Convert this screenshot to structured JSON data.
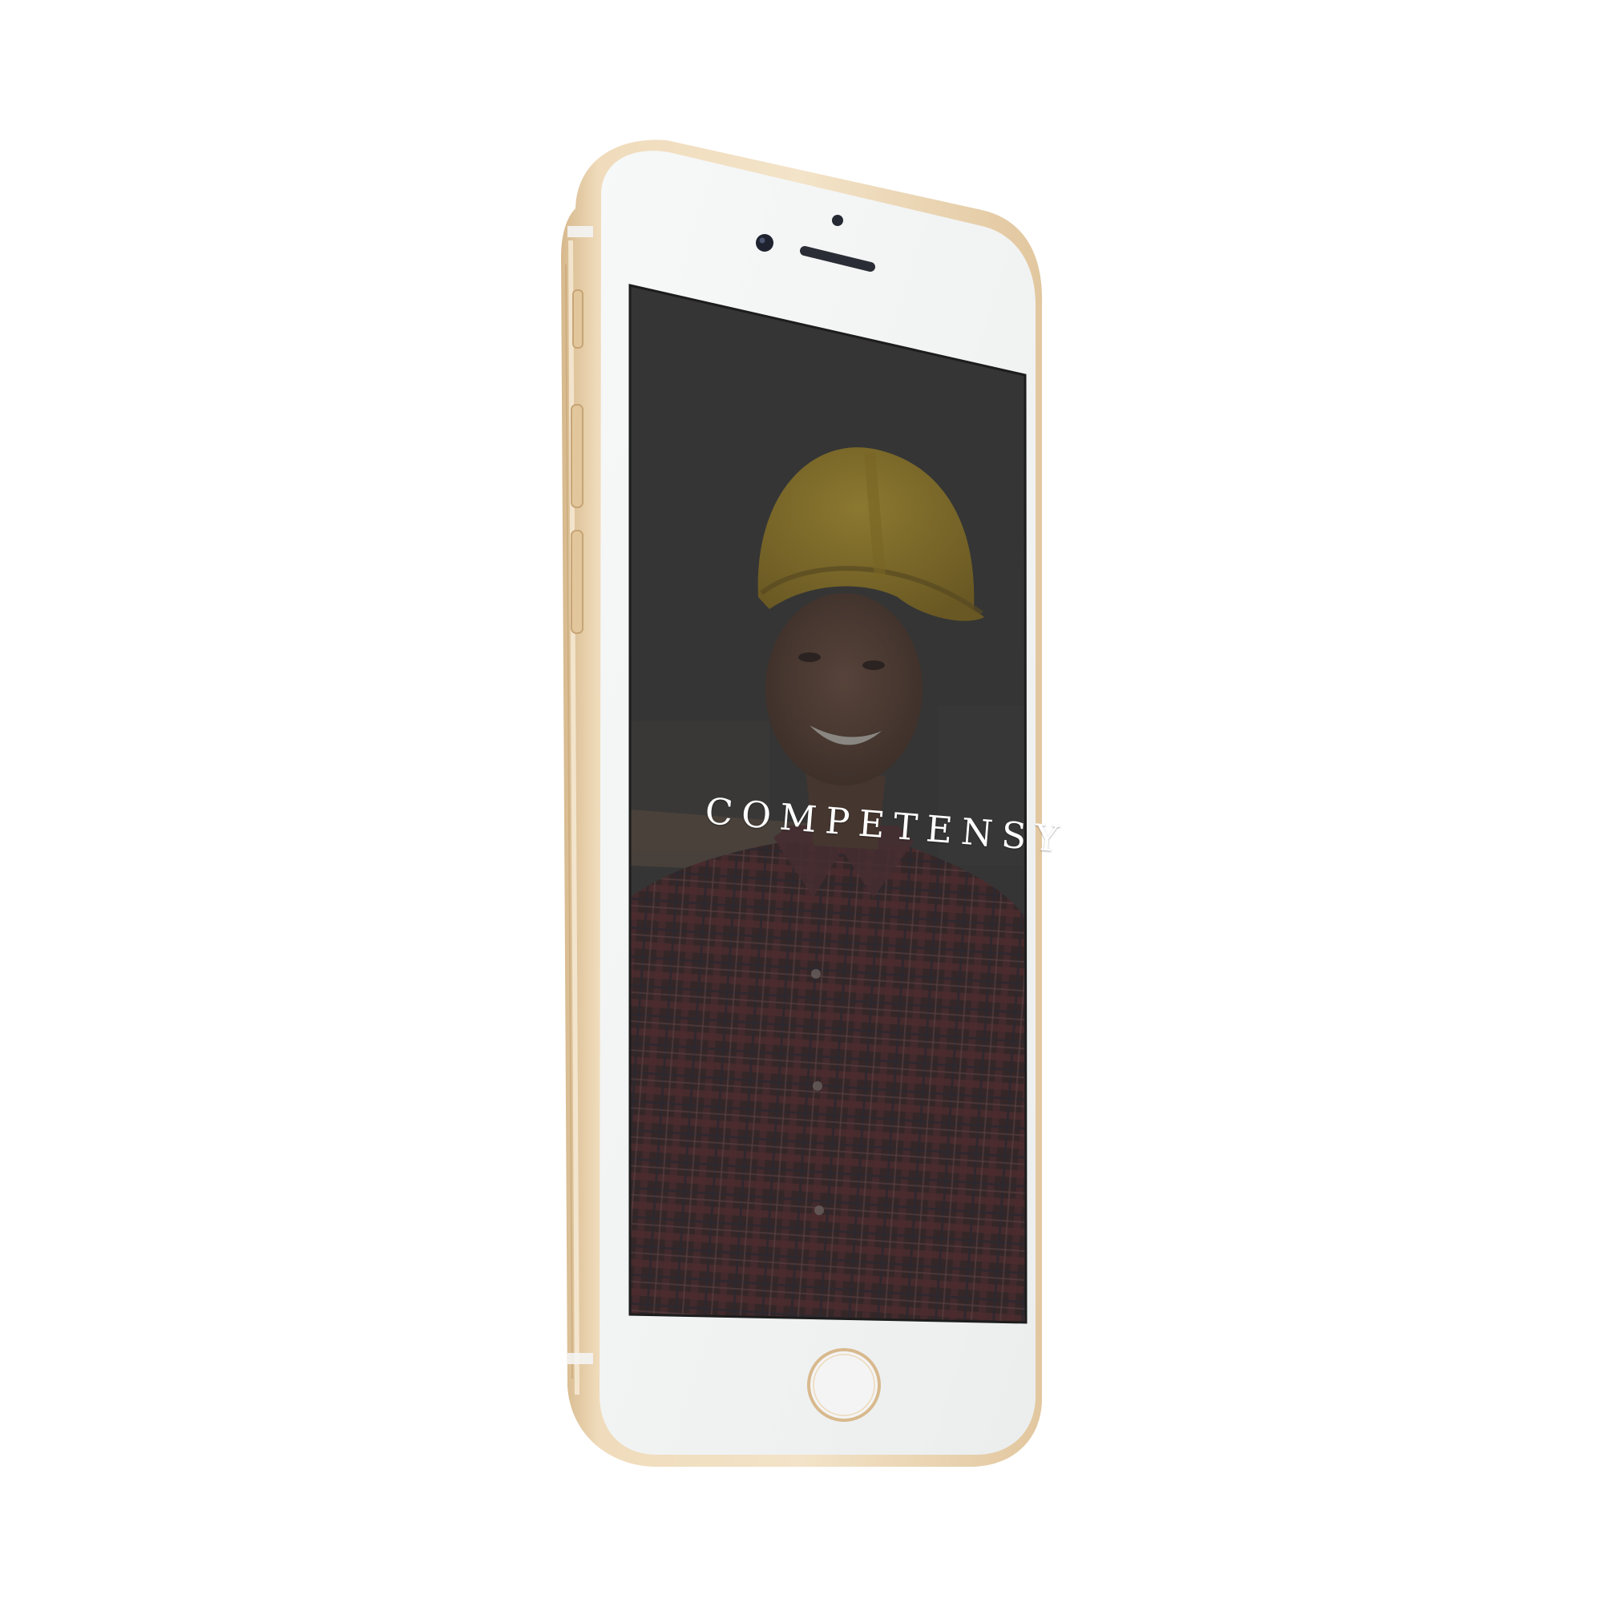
{
  "app": {
    "brand_name": "COMPETENSY"
  },
  "device": {
    "model": "smartphone",
    "frame_color": "#e8cfa7",
    "bezel_color": "#f2f3f3"
  },
  "screen": {
    "overlay_color": "#3c3c3c",
    "background_subject": "construction-worker-photo",
    "hard_hat_color": "#c9a32a",
    "shirt_color": "#4a2b2e"
  },
  "icons": {
    "front_camera": "camera-lens-icon",
    "speaker": "earpiece-speaker-icon",
    "proximity_sensor": "sensor-dot-icon",
    "home_button": "home-button-icon"
  }
}
